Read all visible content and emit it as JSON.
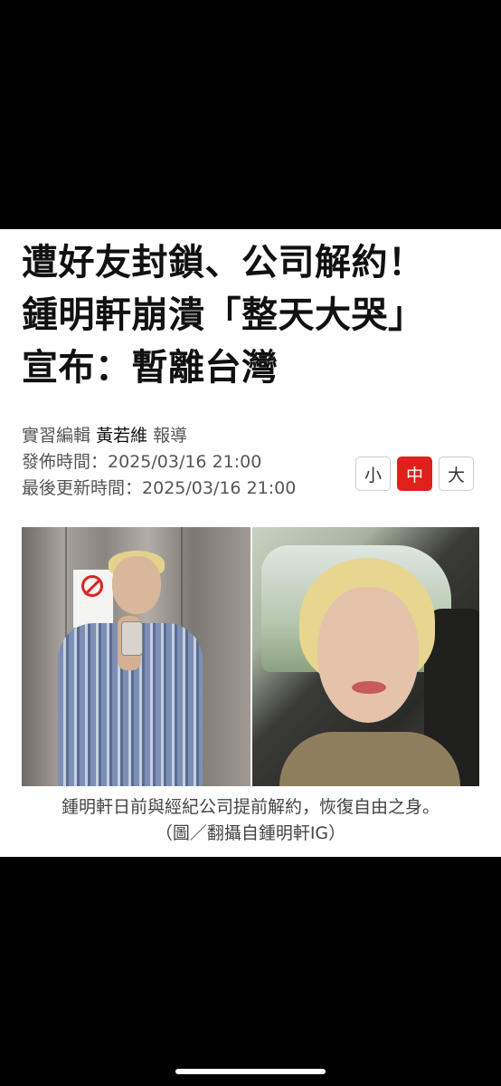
{
  "headline": {
    "line1": "遭好友封鎖、公司解約！",
    "line2": "鍾明軒崩潰「整天大哭」",
    "line3": "宣布：暫離台灣"
  },
  "meta": {
    "role": "實習編輯",
    "author": "黃若維",
    "report": "報導",
    "published_label": "發佈時間：",
    "published": "2025/03/16 21:00",
    "updated_label": "最後更新時間：",
    "updated": "2025/03/16 21:00"
  },
  "font_size": {
    "small": "小",
    "medium": "中",
    "large": "大",
    "selected": "中",
    "accent": "#e0201b"
  },
  "caption": {
    "line1": "鍾明軒日前與經紀公司提前解約，恢復自由之身。",
    "line2": "（圖／翻攝自鍾明軒IG）"
  }
}
